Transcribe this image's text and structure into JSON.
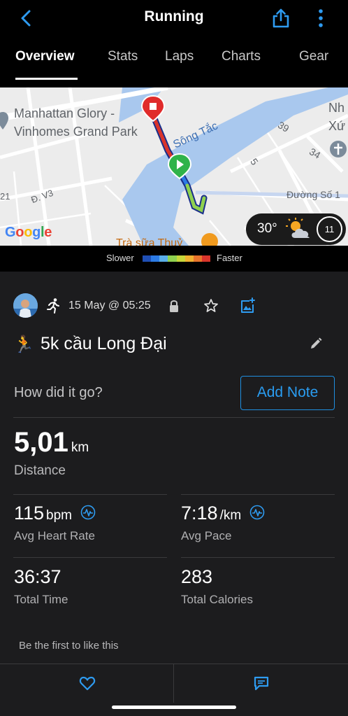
{
  "header": {
    "title": "Running",
    "tabs": [
      {
        "label": "Overview",
        "active": true
      },
      {
        "label": "Stats",
        "active": false
      },
      {
        "label": "Laps",
        "active": false
      },
      {
        "label": "Charts",
        "active": false
      },
      {
        "label": "Gear",
        "active": false
      }
    ]
  },
  "map": {
    "labels": {
      "place_line1": "Manhattan Glory -",
      "place_line2": "Vinhomes Grand Park",
      "river": "Sông Tắc",
      "road_39": "39",
      "road_34": "34",
      "road_5": "5",
      "nh_line1": "Nh",
      "nh_line2": "Xứ",
      "road_d1": "Đường Số 1",
      "road_v3": "Đ. V3",
      "road_21": "21",
      "shop": "Trà sữa Thuỷ"
    },
    "attribution": "Google",
    "weather": {
      "temperature": "30°",
      "time_badge": "11"
    }
  },
  "legend": {
    "slower": "Slower",
    "faster": "Faster",
    "colors": [
      "#1f4fb5",
      "#2c7be5",
      "#5aaee8",
      "#8fd14f",
      "#c7d63a",
      "#f0b030",
      "#e8742c",
      "#d9342b"
    ]
  },
  "activity": {
    "date": "15 May @ 05:25",
    "emoji": "🏃",
    "name": "5k cầu Long Đại",
    "question": "How did it go?",
    "add_note": "Add Note",
    "distance": {
      "value": "5,01",
      "unit": "km",
      "label": "Distance"
    },
    "heart_rate": {
      "value": "115",
      "unit": "bpm",
      "label": "Avg Heart Rate"
    },
    "pace": {
      "value": "7:18",
      "unit": "/km",
      "label": "Avg Pace"
    },
    "total_time": {
      "value": "36:37",
      "label": "Total Time"
    },
    "calories": {
      "value": "283",
      "label": "Total Calories"
    },
    "like_prompt": "Be the first to like this"
  }
}
